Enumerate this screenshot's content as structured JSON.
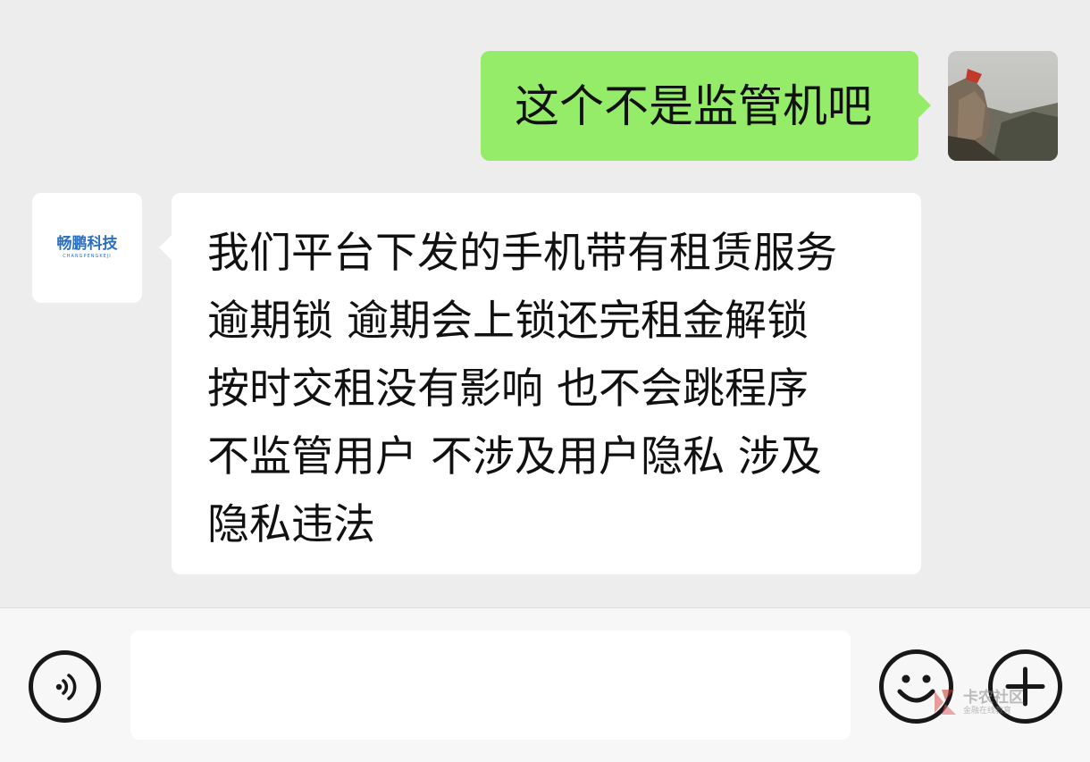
{
  "conversation": {
    "outgoing": {
      "text": "这个不是监管机吧",
      "avatar_icon": "landscape-photo-avatar"
    },
    "incoming": {
      "avatar_logo_text": "畅鹏科技",
      "avatar_logo_subtext": "CHANGPENGKEJI",
      "lines": [
        "我们平台下发的手机带有租赁服务",
        "逾期锁 逾期会上锁还完租金解锁",
        "按时交租没有影响 也不会跳程序",
        "不监管用户 不涉及用户隐私 涉及",
        "隐私违法"
      ]
    }
  },
  "input_bar": {
    "voice_icon": "voice-icon",
    "input_value": "",
    "emoji_icon": "emoji-icon",
    "plus_icon": "plus-icon"
  },
  "watermark": {
    "text": "卡农社区",
    "subtext": "金融在线教育"
  },
  "colors": {
    "chat_background": "#ededed",
    "outgoing_bubble": "#95ec69",
    "incoming_bubble": "#ffffff",
    "input_bar_background": "#f7f7f7",
    "logo_blue": "#2b6fc0"
  }
}
